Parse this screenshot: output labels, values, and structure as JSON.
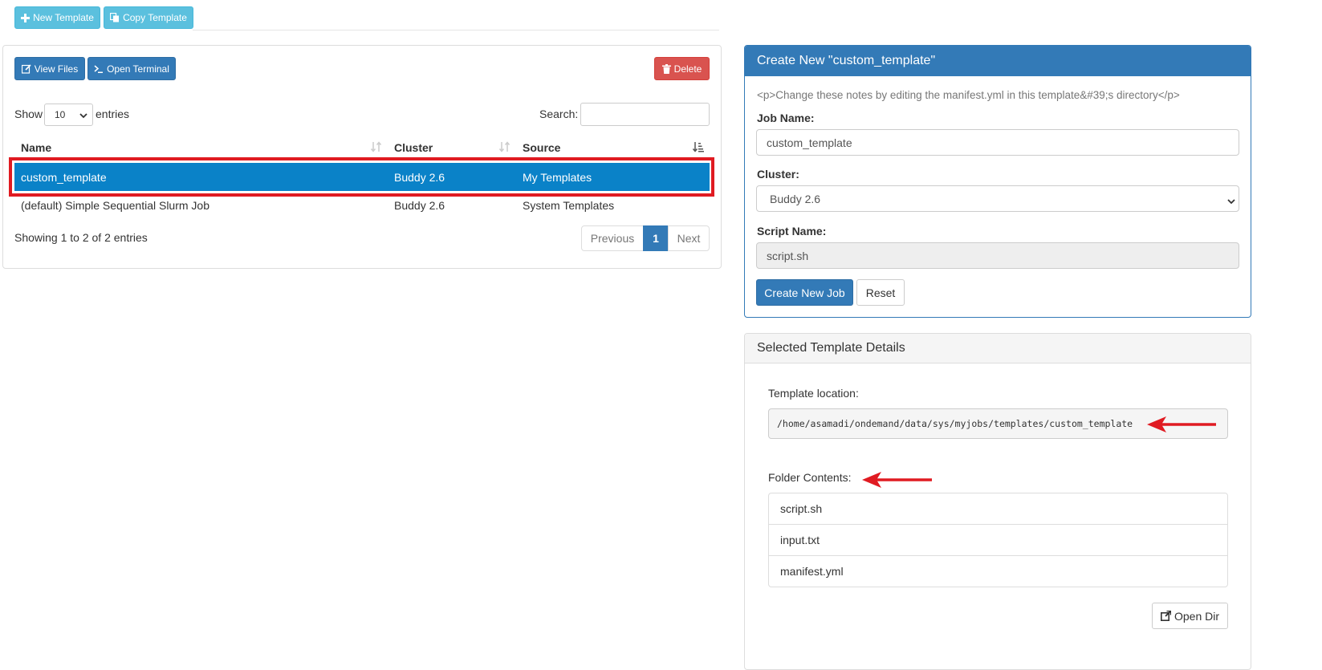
{
  "toolbar": {
    "new_template": "New Template",
    "copy_template": "Copy Template"
  },
  "actions": {
    "view_files": "View Files",
    "open_terminal": "Open Terminal",
    "delete": "Delete"
  },
  "table_controls": {
    "show_label": "Show",
    "entries_value": "10",
    "entries_label": "entries",
    "search_label": "Search:",
    "search_value": ""
  },
  "table": {
    "columns": [
      "Name",
      "Cluster",
      "Source"
    ],
    "rows": [
      {
        "name": "custom_template",
        "cluster": "Buddy 2.6",
        "source": "My Templates",
        "selected": true
      },
      {
        "name": "(default) Simple Sequential Slurm Job",
        "cluster": "Buddy 2.6",
        "source": "System Templates",
        "selected": false
      }
    ],
    "info": "Showing 1 to 2 of 2 entries",
    "pagination": {
      "previous": "Previous",
      "current": "1",
      "next": "Next"
    }
  },
  "create_panel": {
    "title": "Create New \"custom_template\"",
    "notes": "<p>Change these notes by editing the manifest.yml in this template&#39;s directory</p>",
    "job_name_label": "Job Name:",
    "job_name_value": "custom_template",
    "cluster_label": "Cluster:",
    "cluster_value": "Buddy 2.6",
    "script_name_label": "Script Name:",
    "script_name_value": "script.sh",
    "create_button": "Create New Job",
    "reset_button": "Reset"
  },
  "details_panel": {
    "title": "Selected Template Details",
    "location_label": "Template location:",
    "location_value": "/home/asamadi/ondemand/data/sys/myjobs/templates/custom_template",
    "folder_label": "Folder Contents:",
    "files": [
      "script.sh",
      "input.txt",
      "manifest.yml"
    ],
    "open_dir_button": "Open Dir"
  },
  "colors": {
    "info": "#5bc0de",
    "primary": "#337ab7",
    "danger": "#d9534f",
    "selected_row": "#0a82c8",
    "annotation_red": "#e01b22"
  },
  "icons": [
    "plus-icon",
    "copy-icon",
    "edit-icon",
    "terminal-icon",
    "trash-icon",
    "sort-icon",
    "sort-alpha-icon",
    "chevron-down-icon",
    "external-link-icon",
    "arrow-left-icon"
  ]
}
